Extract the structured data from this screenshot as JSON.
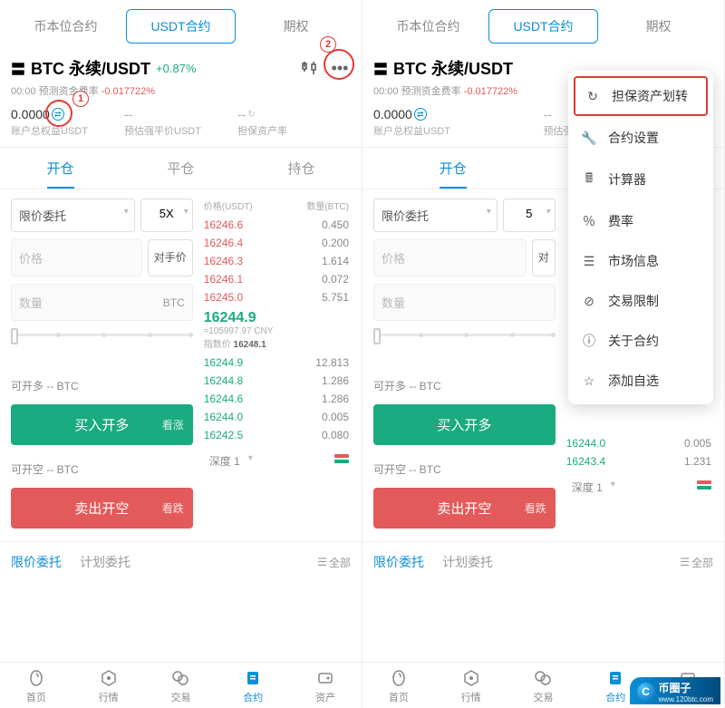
{
  "top_tabs": [
    "币本位合约",
    "USDT合约",
    "期权"
  ],
  "pair": {
    "icon": "〓",
    "name": "BTC 永续/USDT",
    "change": "+0.87%"
  },
  "fee": {
    "prefix": "00:00 预测资金费率",
    "rate": "-0.017722%"
  },
  "balances": [
    {
      "value": "0.0000",
      "label": "账户总权益USDT",
      "icon": true
    },
    {
      "value": "--",
      "label": "预估强平价USDT"
    },
    {
      "value": "--",
      "label": "担保资产率"
    }
  ],
  "pos_tabs": [
    "开仓",
    "平仓",
    "持仓"
  ],
  "order_type": "限价委托",
  "leverage": "5X",
  "price_placeholder": "价格",
  "counter_label": "对手价",
  "qty_placeholder": "数量",
  "qty_unit": "BTC",
  "orderbook": {
    "head_price": "价格(USDT)",
    "head_qty": "数量(BTC)",
    "asks": [
      [
        "16246.6",
        "0.450"
      ],
      [
        "16246.4",
        "0.200"
      ],
      [
        "16246.3",
        "1.614"
      ],
      [
        "16246.1",
        "0.072"
      ],
      [
        "16245.0",
        "5.751"
      ]
    ],
    "mid_price": "16244.9",
    "mid_cny": "≈105997.97 CNY",
    "index_label": "指数价",
    "index_val": "16248.1",
    "bids": [
      [
        "16244.9",
        "12.813"
      ],
      [
        "16244.8",
        "1.286"
      ],
      [
        "16244.6",
        "1.286"
      ],
      [
        "16244.0",
        "0.005"
      ],
      [
        "16242.5",
        "0.080"
      ]
    ],
    "bids_right": [
      [
        "16244.0",
        "0.005"
      ],
      [
        "16243.4",
        "1.231"
      ]
    ],
    "depth": "深度 1"
  },
  "avail_long": "可开多 -- BTC",
  "avail_short": "可开空 -- BTC",
  "btn_long": "买入开多",
  "btn_long_tag": "看涨",
  "btn_short": "卖出开空",
  "btn_short_tag": "看跌",
  "order_tabs": [
    "限价委托",
    "计划委托"
  ],
  "order_all": "全部",
  "nav": [
    {
      "label": "首页",
      "icon": "home"
    },
    {
      "label": "行情",
      "icon": "market"
    },
    {
      "label": "交易",
      "icon": "trade"
    },
    {
      "label": "合约",
      "icon": "contract",
      "active": true
    },
    {
      "label": "资产",
      "icon": "wallet"
    }
  ],
  "menu": [
    {
      "icon": "↻",
      "label": "担保资产划转",
      "hl": true
    },
    {
      "icon": "🔧",
      "label": "合约设置"
    },
    {
      "icon": "🖩",
      "label": "计算器"
    },
    {
      "icon": "％",
      "label": "费率"
    },
    {
      "icon": "☰",
      "label": "市场信息"
    },
    {
      "icon": "⊘",
      "label": "交易限制"
    },
    {
      "icon": "ⓘ",
      "label": "关于合约"
    },
    {
      "icon": "☆",
      "label": "添加自选"
    }
  ],
  "ann": {
    "one": "①",
    "two": "②"
  },
  "watermark": {
    "brand": "币圈子",
    "url": "www.120btc.com"
  }
}
